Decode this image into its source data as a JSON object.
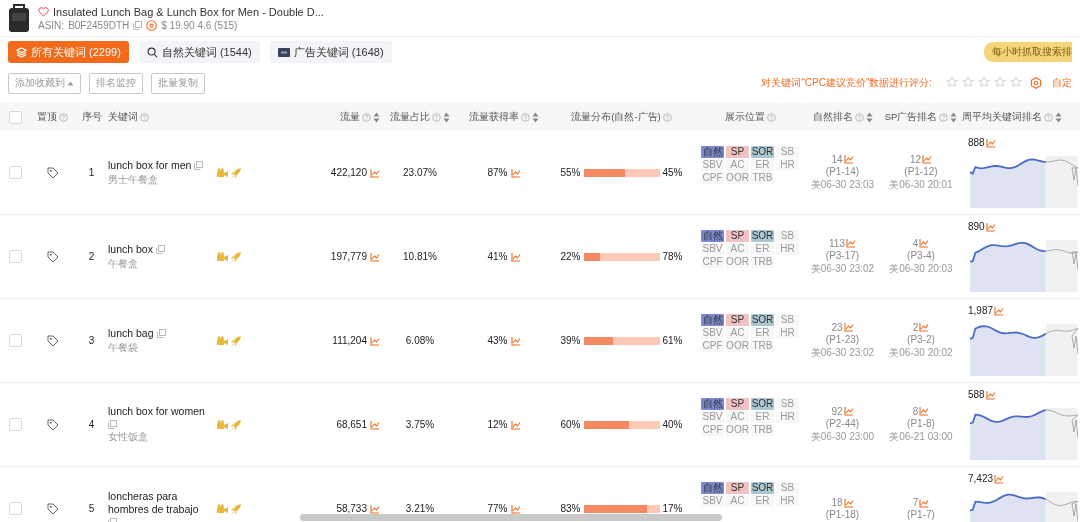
{
  "product": {
    "title": "Insulated Lunch Bag & Lunch Box for Men - Double D...",
    "asin_label": "ASIN:",
    "asin": "B0F2459DTH",
    "price_rating": "$ 19.90 4.6 (515)"
  },
  "tabs": [
    {
      "label": "所有关键词 (2299)",
      "kind": "all",
      "selected": true
    },
    {
      "label": "自然关键词 (1544)",
      "kind": "organic",
      "selected": false
    },
    {
      "label": "广告关键词 (1648)",
      "kind": "ad",
      "selected": false
    }
  ],
  "notice": "每小时抓取搜索排",
  "actions": [
    {
      "label": "添加收藏到",
      "kind": "dropdown"
    },
    {
      "label": "排名监控",
      "kind": "plain"
    },
    {
      "label": "批量复制",
      "kind": "plain"
    }
  ],
  "rating": {
    "label": "对关键词“CPC建议竞价”数据进行评分:",
    "stars": 0,
    "custom": "自定"
  },
  "table": {
    "select_all_checked": false,
    "columns": [
      {
        "label": "置顶",
        "help": true,
        "sortable": false
      },
      {
        "label": "序号",
        "help": false,
        "sortable": false
      },
      {
        "label": "关键词",
        "help": true,
        "sortable": false
      },
      {
        "label": "流量",
        "help": true,
        "sortable": true
      },
      {
        "label": "流量占比",
        "help": true,
        "sortable": true
      },
      {
        "label": "流量获得率",
        "help": true,
        "sortable": true
      },
      {
        "label": "流量分布(自然-广告)",
        "help": true,
        "sortable": false
      },
      {
        "label": "展示位置",
        "help": true,
        "sortable": false
      },
      {
        "label": "自然排名",
        "help": true,
        "sortable": true
      },
      {
        "label": "SP广告排名",
        "help": true,
        "sortable": true
      },
      {
        "label": "周平均关键词排名",
        "help": true,
        "sortable": true
      }
    ],
    "rows": [
      {
        "checked": false,
        "index": "1",
        "keyword": "lunch box for men",
        "translation": "男士午餐盒",
        "flow": "422,120",
        "share": "23.07%",
        "rate": "87%",
        "organic_pct": "55%",
        "level": 0.55,
        "ad_pct": "45%",
        "placements": [
          {
            "label": "自然",
            "on": true,
            "color": "#7b88cc"
          },
          {
            "label": "SP",
            "on": true,
            "color": "#f2c1c4"
          },
          {
            "label": "SOR",
            "on": true,
            "color": "#a9c6d2"
          },
          {
            "label": "SB",
            "on": false
          },
          {
            "label": "SBV",
            "on": false
          },
          {
            "label": "AC",
            "on": false
          },
          {
            "label": "ER",
            "on": false
          },
          {
            "label": "HR",
            "on": false
          },
          {
            "label": "CPF",
            "on": false
          },
          {
            "label": "OOR",
            "on": false
          },
          {
            "label": "TRB",
            "on": false
          }
        ],
        "natural_rank": "14",
        "natural_page": "(P1-14)",
        "natural_time": "美06-30 23:03",
        "sp_rank": "12",
        "sp_page": "(P1-12)",
        "sp_time": "美06-30 20:01",
        "weekly": "888"
      },
      {
        "checked": false,
        "index": "2",
        "keyword": "lunch box",
        "translation": "午餐盒",
        "flow": "197,779",
        "share": "10.81%",
        "rate": "41%",
        "organic_pct": "22%",
        "level": 0.22,
        "ad_pct": "78%",
        "placements": [
          {
            "label": "自然",
            "on": true,
            "color": "#7b88cc"
          },
          {
            "label": "SP",
            "on": true,
            "color": "#f2c1c4"
          },
          {
            "label": "SOR",
            "on": true,
            "color": "#a9c6d2"
          },
          {
            "label": "SB",
            "on": false
          },
          {
            "label": "SBV",
            "on": false
          },
          {
            "label": "AC",
            "on": false
          },
          {
            "label": "ER",
            "on": false
          },
          {
            "label": "HR",
            "on": false
          },
          {
            "label": "CPF",
            "on": false
          },
          {
            "label": "OOR",
            "on": false
          },
          {
            "label": "TRB",
            "on": false
          }
        ],
        "natural_rank": "113",
        "natural_page": "(P3-17)",
        "natural_time": "美06-30 23:02",
        "sp_rank": "4",
        "sp_page": "(P3-4)",
        "sp_time": "美06-30 20:03",
        "weekly": "890"
      },
      {
        "checked": false,
        "index": "3",
        "keyword": "lunch bag",
        "translation": "午餐袋",
        "flow": "111,204",
        "share": "6.08%",
        "rate": "43%",
        "organic_pct": "39%",
        "level": 0.39,
        "ad_pct": "61%",
        "placements": [
          {
            "label": "自然",
            "on": true,
            "color": "#7b88cc"
          },
          {
            "label": "SP",
            "on": true,
            "color": "#f2c1c4"
          },
          {
            "label": "SOR",
            "on": true,
            "color": "#a9c6d2"
          },
          {
            "label": "SB",
            "on": false
          },
          {
            "label": "SBV",
            "on": false
          },
          {
            "label": "AC",
            "on": false
          },
          {
            "label": "ER",
            "on": false
          },
          {
            "label": "HR",
            "on": false
          },
          {
            "label": "CPF",
            "on": false
          },
          {
            "label": "OOR",
            "on": false
          },
          {
            "label": "TRB",
            "on": false
          }
        ],
        "natural_rank": "23",
        "natural_page": "(P1-23)",
        "natural_time": "美06-30 23:02",
        "sp_rank": "2",
        "sp_page": "(P3-2)",
        "sp_time": "美06-30 20:02",
        "weekly": "1,987"
      },
      {
        "checked": false,
        "index": "4",
        "keyword": "lunch box for women",
        "translation": "女性饭盒",
        "flow": "68,651",
        "share": "3.75%",
        "rate": "12%",
        "organic_pct": "60%",
        "level": 0.6,
        "ad_pct": "40%",
        "placements": [
          {
            "label": "自然",
            "on": true,
            "color": "#7b88cc"
          },
          {
            "label": "SP",
            "on": true,
            "color": "#f2c1c4"
          },
          {
            "label": "SOR",
            "on": true,
            "color": "#a9c6d2"
          },
          {
            "label": "SB",
            "on": false
          },
          {
            "label": "SBV",
            "on": false
          },
          {
            "label": "AC",
            "on": false
          },
          {
            "label": "ER",
            "on": false
          },
          {
            "label": "HR",
            "on": false
          },
          {
            "label": "CPF",
            "on": false
          },
          {
            "label": "OOR",
            "on": false
          },
          {
            "label": "TRB",
            "on": false
          }
        ],
        "natural_rank": "92",
        "natural_page": "(P2-44)",
        "natural_time": "美06-30 23:00",
        "sp_rank": "8",
        "sp_page": "(P1-8)",
        "sp_time": "美06-21 03:00",
        "weekly": "588"
      },
      {
        "checked": false,
        "index": "5",
        "keyword": "loncheras para hombres de trabajo",
        "flow": "58,733",
        "share": "3.21%",
        "rate": "77%",
        "organic_pct": "83%",
        "level": 0.83,
        "ad_pct": "17%",
        "placements": [
          {
            "label": "自然",
            "on": true,
            "color": "#7b88cc"
          },
          {
            "label": "SP",
            "on": true,
            "color": "#f2c1c4"
          },
          {
            "label": "SOR",
            "on": true,
            "color": "#a9c6d2"
          },
          {
            "label": "SB",
            "on": false
          },
          {
            "label": "SBV",
            "on": false
          },
          {
            "label": "AC",
            "on": false
          },
          {
            "label": "ER",
            "on": false
          },
          {
            "label": "HR",
            "on": false
          }
        ],
        "natural_rank": "18",
        "natural_page": "(P1-18)",
        "sp_rank": "7",
        "sp_page": "(P1-7)",
        "weekly": "7,423"
      }
    ]
  }
}
